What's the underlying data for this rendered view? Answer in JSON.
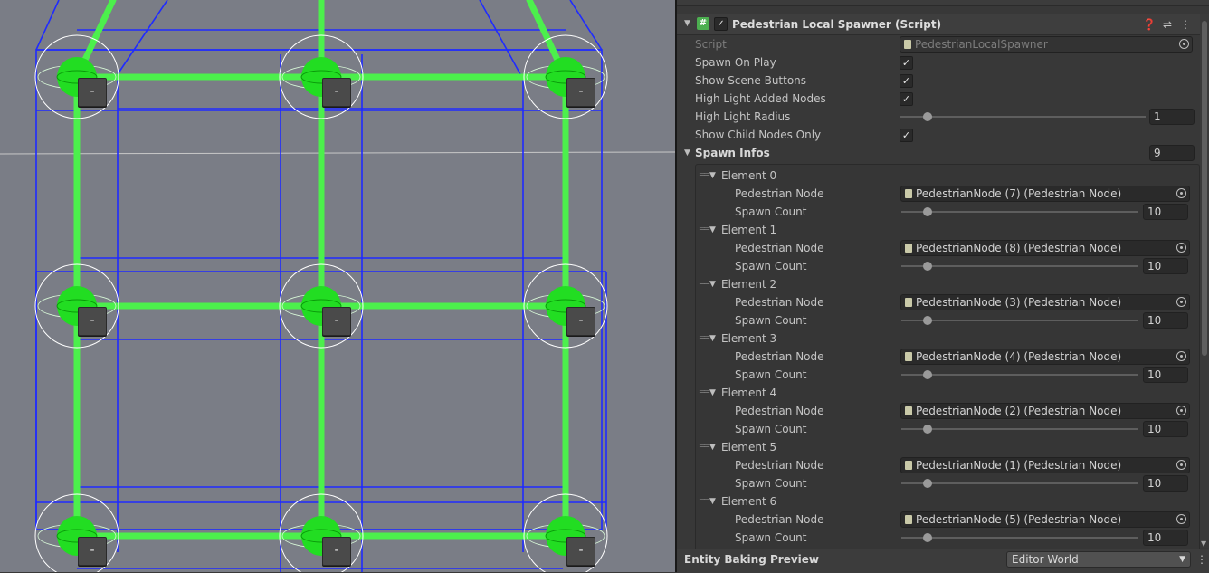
{
  "inspector": {
    "component": {
      "title": "Pedestrian Local Spawner (Script)",
      "enabled": true,
      "icons": [
        "help-icon",
        "presets-icon",
        "kebab-menu-icon"
      ]
    },
    "script": {
      "label": "Script",
      "value": "PedestrianLocalSpawner"
    },
    "spawn_on_play": {
      "label": "Spawn On Play",
      "checked": true
    },
    "show_scene_buttons": {
      "label": "Show Scene Buttons",
      "checked": true
    },
    "high_light_added_nodes": {
      "label": "High Light Added Nodes",
      "checked": true
    },
    "high_light_radius": {
      "label": "High Light Radius",
      "value": "1"
    },
    "show_child_nodes_only": {
      "label": "Show Child Nodes Only",
      "checked": true
    },
    "spawn_infos": {
      "label": "Spawn Infos",
      "size": "9",
      "elements": [
        {
          "label": "Element 0",
          "node_label": "Pedestrian Node",
          "node_value": "PedestrianNode (7) (Pedestrian Node)",
          "count_label": "Spawn Count",
          "count_value": "10"
        },
        {
          "label": "Element 1",
          "node_label": "Pedestrian Node",
          "node_value": "PedestrianNode (8) (Pedestrian Node)",
          "count_label": "Spawn Count",
          "count_value": "10"
        },
        {
          "label": "Element 2",
          "node_label": "Pedestrian Node",
          "node_value": "PedestrianNode (3) (Pedestrian Node)",
          "count_label": "Spawn Count",
          "count_value": "10"
        },
        {
          "label": "Element 3",
          "node_label": "Pedestrian Node",
          "node_value": "PedestrianNode (4) (Pedestrian Node)",
          "count_label": "Spawn Count",
          "count_value": "10"
        },
        {
          "label": "Element 4",
          "node_label": "Pedestrian Node",
          "node_value": "PedestrianNode (2) (Pedestrian Node)",
          "count_label": "Spawn Count",
          "count_value": "10"
        },
        {
          "label": "Element 5",
          "node_label": "Pedestrian Node",
          "node_value": "PedestrianNode (1) (Pedestrian Node)",
          "count_label": "Spawn Count",
          "count_value": "10"
        },
        {
          "label": "Element 6",
          "node_label": "Pedestrian Node",
          "node_value": "PedestrianNode (5) (Pedestrian Node)",
          "count_label": "Spawn Count",
          "count_value": "10"
        }
      ]
    }
  },
  "footer": {
    "title": "Entity Baking Preview",
    "dropdown_value": "Editor World"
  },
  "scene": {
    "node_button_label": "-",
    "colors": {
      "background": "#7a7d86",
      "path": "#4cf04c",
      "outline": "#1f2bff",
      "node": "#22dd22"
    }
  }
}
